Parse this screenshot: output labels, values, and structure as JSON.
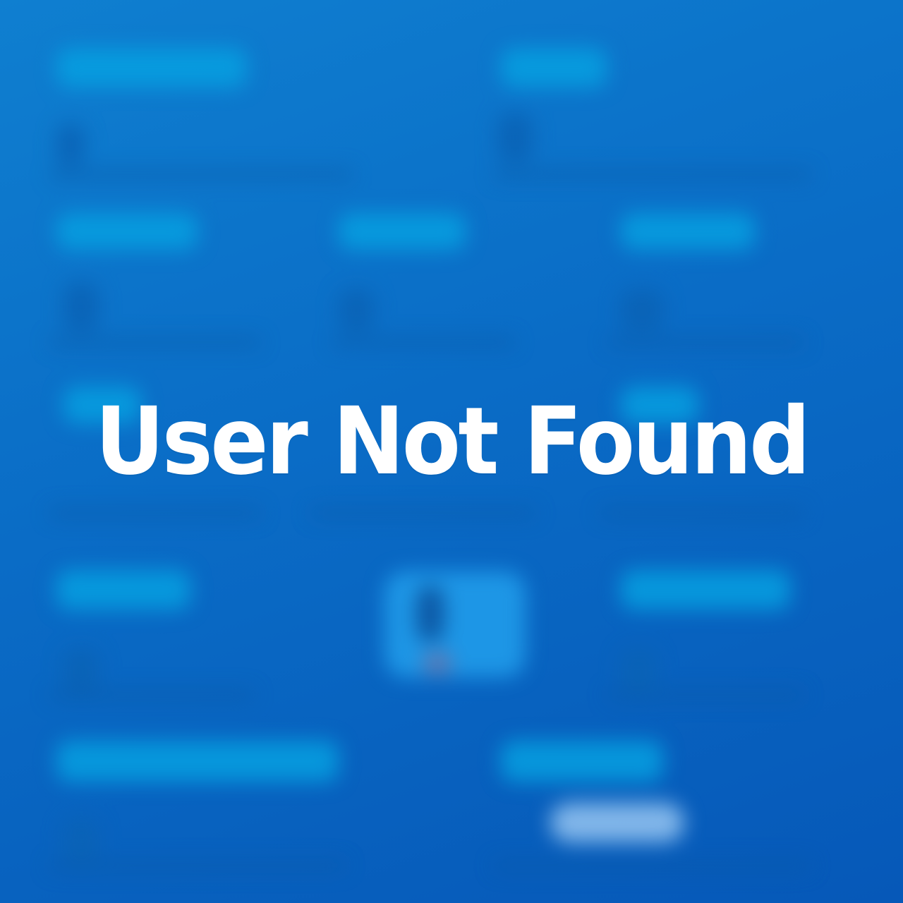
{
  "overlay": {
    "message": "User Not Found"
  },
  "colors": {
    "background_top": "#0f7fd0",
    "background_bottom": "#0658b8",
    "text": "#ffffff"
  }
}
